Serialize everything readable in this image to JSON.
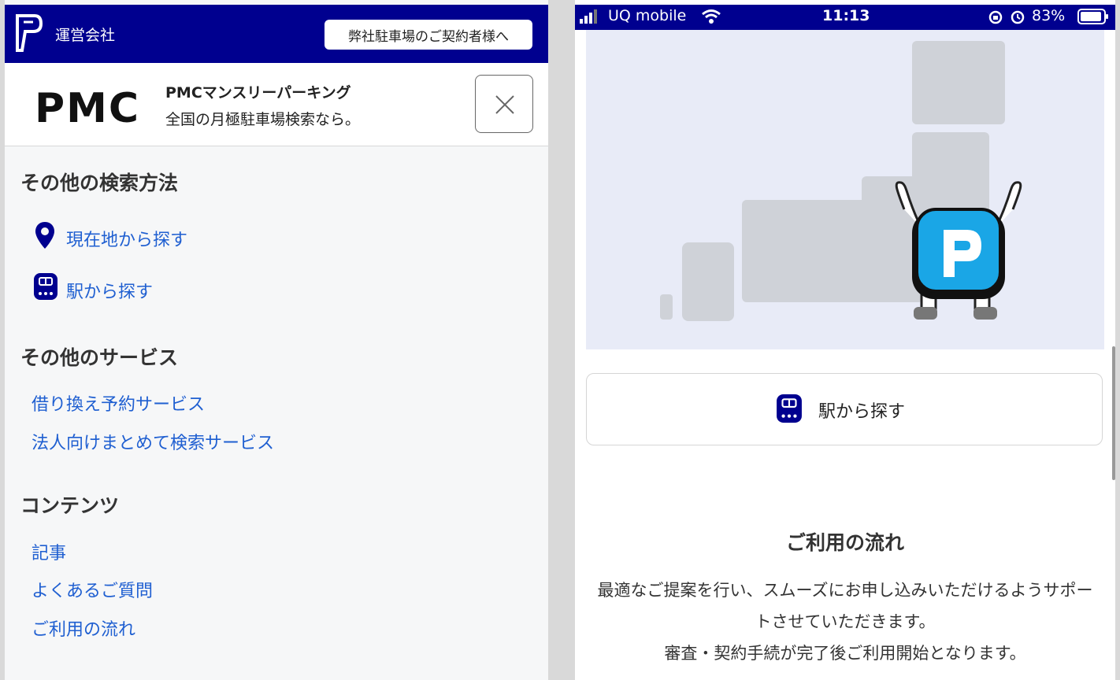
{
  "left": {
    "header": {
      "company_link": "運営会社",
      "contract_button": "弊社駐車場のご契約者様へ"
    },
    "brand": {
      "logo_text": "PMC",
      "title": "PMCマンスリーパーキング",
      "subtitle": "全国の月極駐車場検索なら。"
    },
    "sections": {
      "search": {
        "title": "その他の検索方法",
        "current_location": "現在地から探す",
        "station": "駅から探す"
      },
      "services": {
        "title": "その他のサービス",
        "items": [
          "借り換え予約サービス",
          "法人向けまとめて検索サービス"
        ]
      },
      "contents": {
        "title": "コンテンツ",
        "items": [
          "記事",
          "よくあるご質問",
          "ご利用の流れ"
        ]
      }
    }
  },
  "right": {
    "status": {
      "carrier": "UQ mobile",
      "time": "11:13",
      "battery": "83%"
    },
    "station_button": "駅から探す",
    "flow": {
      "title": "ご利用の流れ",
      "line1": "最適なご提案を行い、スムーズにお申し込みいただけるようサポートさせていただきます。",
      "line2": "審査・契約手続が完了後ご利用開始となります。"
    }
  },
  "colors": {
    "navy": "#00008f",
    "link_blue": "#1f5fd1",
    "mascot_blue": "#1aa6e6",
    "map_land": "#cfd2d8"
  }
}
